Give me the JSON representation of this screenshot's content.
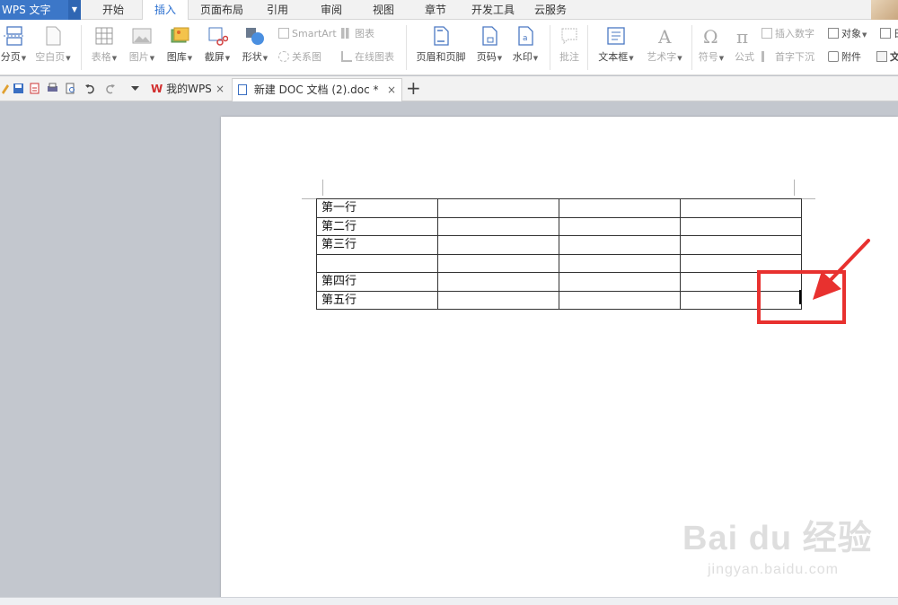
{
  "app": {
    "title": "WPS 文字"
  },
  "menu": [
    {
      "label": "开始"
    },
    {
      "label": "插入"
    },
    {
      "label": "页面布局"
    },
    {
      "label": "引用"
    },
    {
      "label": "审阅"
    },
    {
      "label": "视图"
    },
    {
      "label": "章节"
    },
    {
      "label": "开发工具"
    },
    {
      "label": "云服务"
    }
  ],
  "ribbon": {
    "page_break": "分页",
    "blank_page": "空白页",
    "table": "表格",
    "picture": "图片",
    "gallery": "图库",
    "screenshot": "截屏",
    "shapes": "形状",
    "smartart": "SmartArt",
    "relation": "关系图",
    "chart": "图表",
    "online_chart": "在线图表",
    "header_footer": "页眉和页脚",
    "page_number": "页码",
    "watermark": "水印",
    "comment": "批注",
    "textbox": "文本框",
    "wordart": "艺术字",
    "symbol": "符号",
    "formula": "公式",
    "insert_number": "插入数字",
    "object": "对象",
    "drop_cap": "首字下沉",
    "attachment": "附件",
    "date_frag": "日",
    "text_frag": "文"
  },
  "quickbar": {
    "tabs": [
      {
        "label": "我的WPS"
      },
      {
        "label": "新建 DOC 文档 (2).doc *"
      }
    ],
    "close": "×",
    "add": "+"
  },
  "document": {
    "table": {
      "rows": [
        [
          "第一行",
          "",
          "",
          ""
        ],
        [
          "第二行",
          "",
          "",
          ""
        ],
        [
          "第三行",
          "",
          "",
          ""
        ],
        [
          "",
          "",
          "",
          ""
        ],
        [
          "第四行",
          "",
          "",
          ""
        ],
        [
          "第五行",
          "",
          "",
          ""
        ]
      ]
    }
  },
  "watermark": {
    "logo": "Bai du 经验",
    "url": "jingyan.baidu.com"
  },
  "colors": {
    "accent": "#3c77c8",
    "highlight": "#e8312f"
  }
}
